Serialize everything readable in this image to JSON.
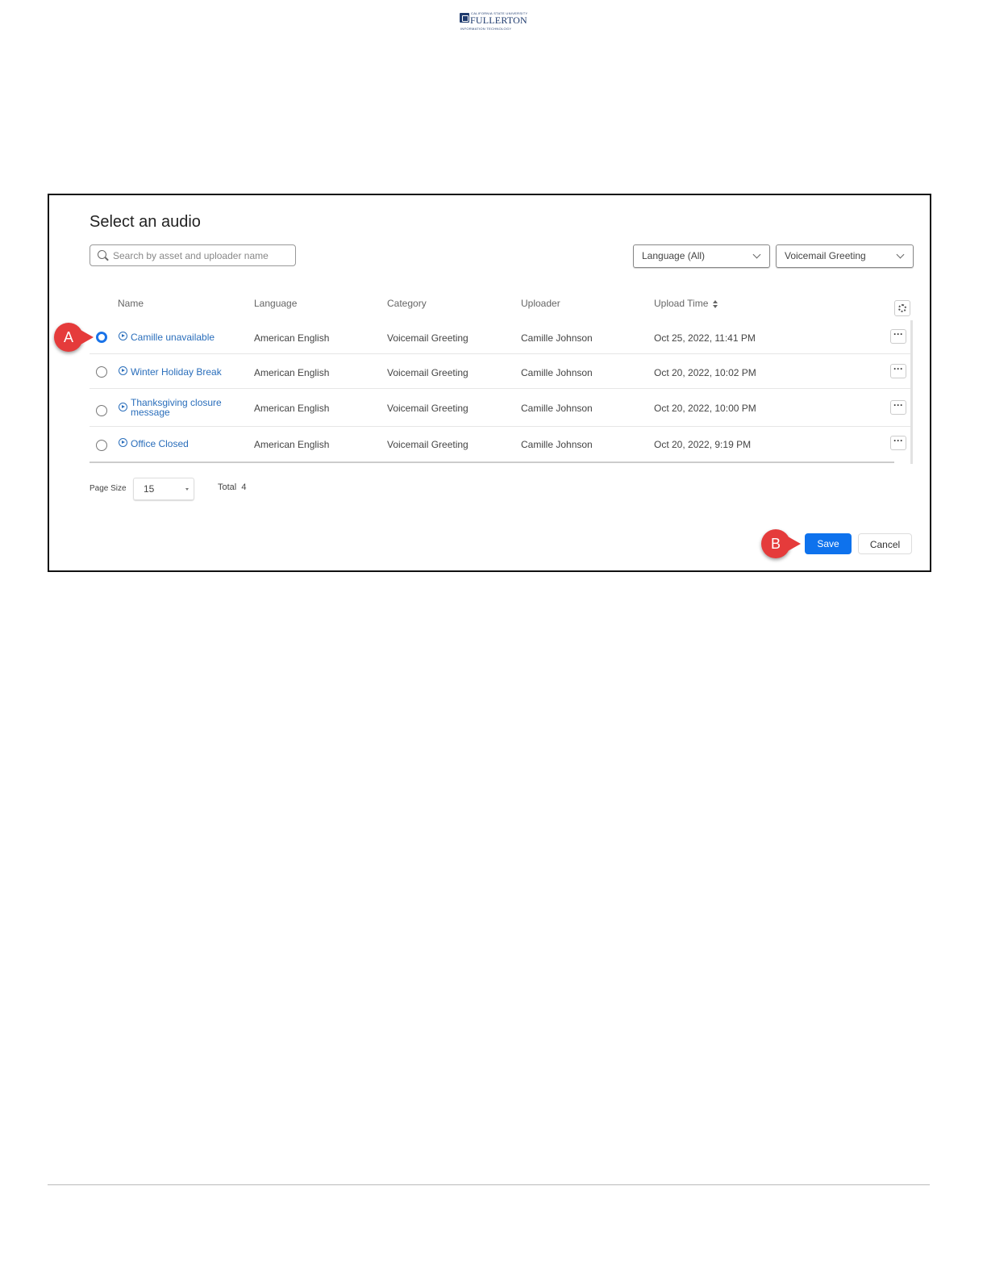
{
  "logo": {
    "top_text": "CALIFORNIA STATE UNIVERSITY",
    "main_text": "FULLERTON",
    "sub_text": "INFORMATION TECHNOLOGY"
  },
  "dialog": {
    "title": "Select an audio",
    "search_placeholder": "Search by asset and uploader name",
    "language_filter": "Language (All)",
    "category_filter": "Voicemail Greeting",
    "columns": {
      "name": "Name",
      "language": "Language",
      "category": "Category",
      "uploader": "Uploader",
      "upload_time": "Upload Time"
    },
    "rows": [
      {
        "name": "Camille unavailable",
        "language": "American English",
        "category": "Voicemail Greeting",
        "uploader": "Camille Johnson",
        "upload_time": "Oct 25, 2022, 11:41 PM",
        "selected": true
      },
      {
        "name": "Winter Holiday Break",
        "language": "American English",
        "category": "Voicemail Greeting",
        "uploader": "Camille Johnson",
        "upload_time": "Oct 20, 2022, 10:02 PM",
        "selected": false
      },
      {
        "name": "Thanksgiving closure message",
        "language": "American English",
        "category": "Voicemail Greeting",
        "uploader": "Camille Johnson",
        "upload_time": "Oct 20, 2022, 10:00 PM",
        "selected": false
      },
      {
        "name": "Office Closed",
        "language": "American English",
        "category": "Voicemail Greeting",
        "uploader": "Camille Johnson",
        "upload_time": "Oct 20, 2022, 9:19 PM",
        "selected": false
      }
    ],
    "more_label": "···",
    "page_size_label": "Page Size",
    "page_size_value": "15",
    "total_label": "Total",
    "total_value": "4",
    "save_label": "Save",
    "cancel_label": "Cancel"
  },
  "markers": {
    "a": "A",
    "b": "B"
  },
  "colors": {
    "accent": "#0e72ed",
    "link": "#2a6ebb",
    "marker": "#e53b3b"
  }
}
